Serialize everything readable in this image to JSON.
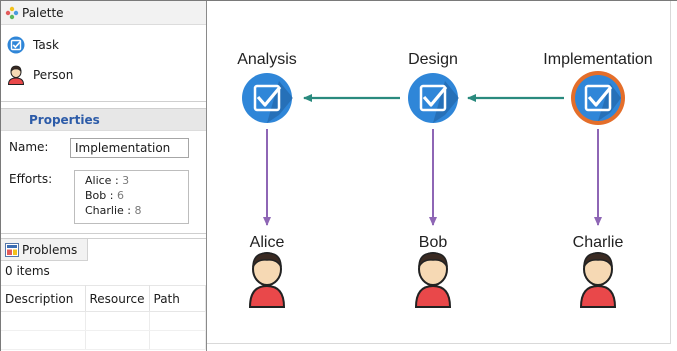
{
  "palette": {
    "title": "Palette",
    "items": [
      {
        "label": "Task",
        "icon": "task-icon"
      },
      {
        "label": "Person",
        "icon": "person-icon"
      }
    ]
  },
  "properties": {
    "title": "Properties",
    "name_label": "Name:",
    "name_value": "Implementation",
    "efforts_label": "Efforts:",
    "efforts": [
      {
        "name": "Alice",
        "value": "3"
      },
      {
        "name": "Bob",
        "value": "6"
      },
      {
        "name": "Charlie",
        "value": "8"
      }
    ]
  },
  "problems": {
    "title": "Problems",
    "count": "0 items",
    "columns": [
      "Description",
      "Resource",
      "Path"
    ]
  },
  "diagram": {
    "tasks": [
      "Analysis",
      "Design",
      "Implementation"
    ],
    "people": [
      "Alice",
      "Bob",
      "Charlie"
    ],
    "selected_task": "Implementation",
    "colors": {
      "task_fill": "#2f86d8",
      "selected_ring": "#e46e2a",
      "flow_arrow": "#2a8a7e",
      "assign_arrow": "#8e66b5",
      "person_shirt": "#e9484a"
    }
  }
}
